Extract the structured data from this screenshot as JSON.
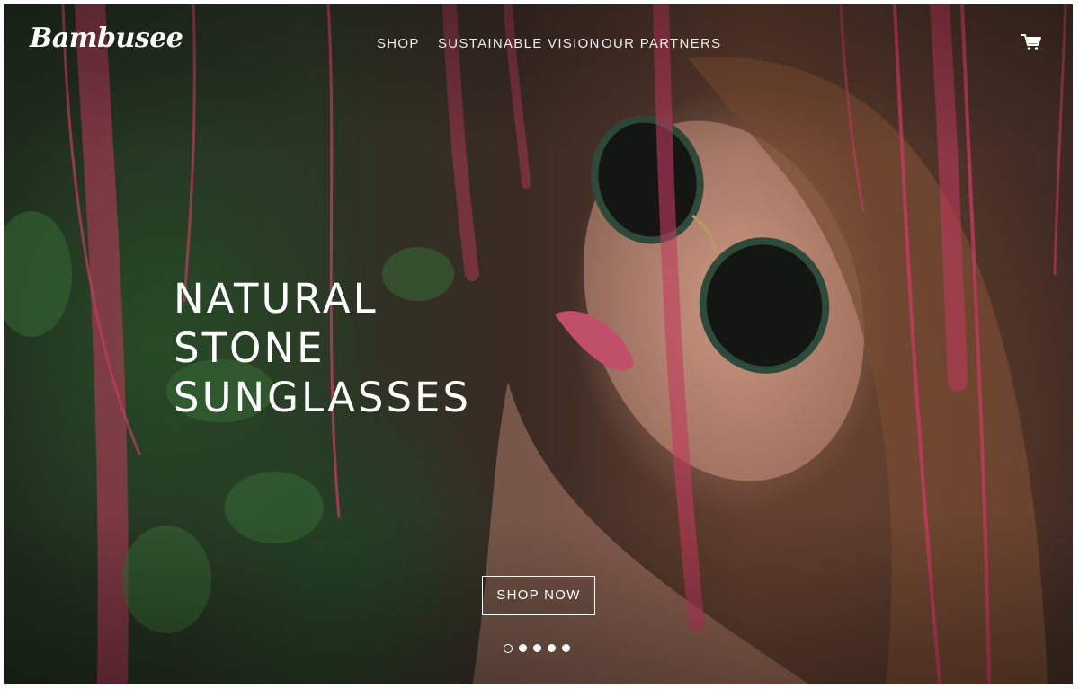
{
  "brand": {
    "logo_text": "Bambusee"
  },
  "nav": {
    "items": [
      {
        "label": "SHOP"
      },
      {
        "label": "SUSTAINABLE VISION"
      },
      {
        "label": "OUR PARTNERS"
      }
    ],
    "cart_icon": "shopping-cart-icon"
  },
  "hero": {
    "headline_lines": [
      "NATURAL",
      "STONE",
      "SUNGLASSES"
    ],
    "cta_label": "SHOP NOW",
    "image_subject": "woman wearing round sunglasses among pink hanging vines",
    "slides": {
      "count": 5,
      "active_index": 0
    }
  },
  "colors": {
    "text": "#ffffff",
    "vine_pink": "#c23a5e",
    "foliage_green": "#2f4a2a",
    "page_border": "#ffffff"
  }
}
